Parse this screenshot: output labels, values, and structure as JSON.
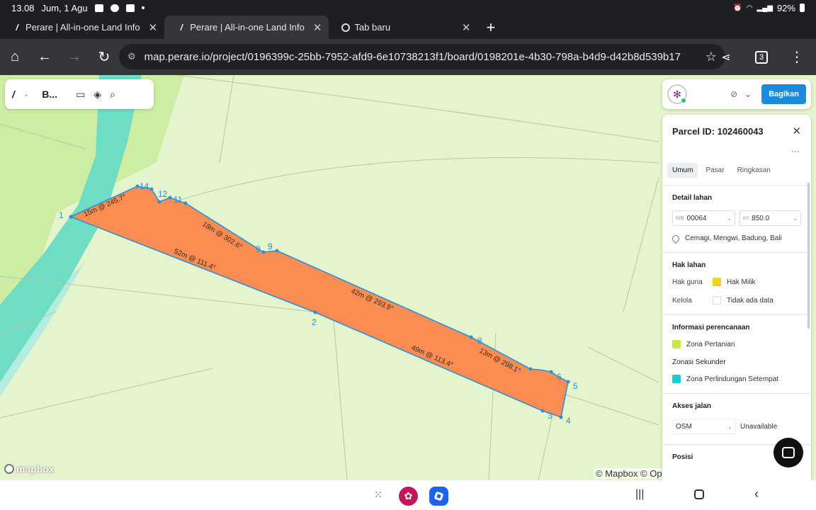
{
  "status_bar": {
    "time": "13.08",
    "date": "Jum, 1 Agu",
    "battery": "92%"
  },
  "tabs": [
    {
      "label": "Perare | All-in-one Land Info",
      "close": "✕"
    },
    {
      "label": "Perare | All-in-one Land Info",
      "close": "✕"
    },
    {
      "label": "Tab baru",
      "close": "✕"
    }
  ],
  "toolbar": {
    "url": "map.perare.io/project/0196399c-25bb-7952-afd9-6e10738213f1/board/0198201e-4b30-798a-b4d9-d42b8d539b17",
    "tab_count": "3"
  },
  "map_tools": {
    "board_label": "B..."
  },
  "map": {
    "mapbox_logo": "mapbox",
    "attribution": "© Mapbox © OpenStreetMap",
    "vertex_labels": [
      "1",
      "2",
      "3",
      "4",
      "5",
      "6",
      "8",
      "9",
      "9",
      "11",
      "12",
      "14"
    ],
    "edge_labels": [
      "15m @ 245.7°",
      "18m @ 302.6°",
      "52m @ 111.4°",
      "42m @ 293.9°",
      "49m @ 113.4°",
      "13m @ 298.1°"
    ],
    "colors": {
      "parcel_fill": "#fb8d52",
      "parcel_stroke": "#2e8fd6",
      "background": "#e4f4cc",
      "river": "#6fdcc4"
    }
  },
  "top_card": {
    "share_label": "Bagikan"
  },
  "panel": {
    "title": "Parcel ID: 102460043",
    "more": "···",
    "tabs": [
      "Umum",
      "Pasar",
      "Ringkasan"
    ],
    "detail": {
      "heading": "Detail lahan",
      "nib_prefix": "NIB",
      "nib_value": "00064",
      "area_prefix": "m²",
      "area_value": "850.0",
      "location": "Cemagi, Mengwi, Badung, Bali"
    },
    "rights": {
      "heading": "Hak lahan",
      "guna_label": "Hak guna",
      "guna_value": "Hak Milik",
      "guna_color": "#f2d21a",
      "kelola_label": "Kelola",
      "kelola_value": "Tidak ada data"
    },
    "planning": {
      "heading": "Informasi perencanaan",
      "zona": "Zona Pertanian",
      "zona_color": "#c5e84a",
      "secondary_heading": "Zonasi Sekunder",
      "zona2": "Zona Perlindungan Setempat",
      "zona2_color": "#1fc9d6"
    },
    "road": {
      "heading": "Akses jalan",
      "source": "OSM",
      "value": "Unavailable"
    },
    "position_heading": "Posisi"
  }
}
